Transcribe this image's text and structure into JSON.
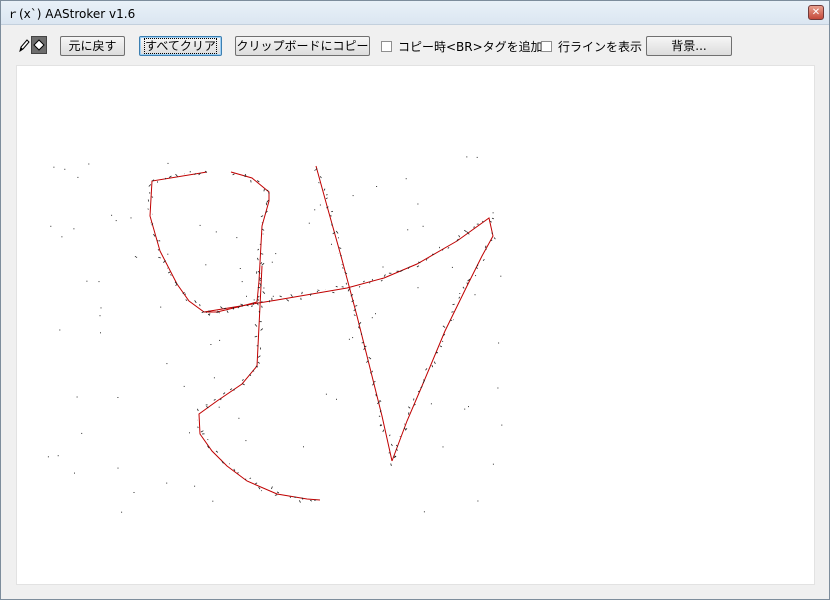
{
  "window": {
    "title": "ｒ(x`) AAStroker v1.6",
    "close_glyph": "✕"
  },
  "toolbar": {
    "undo_label": "元に戻す",
    "clear_all_label": "すべてクリア",
    "copy_label": "クリップボードにコピー",
    "br_tag_label": "コピー時<BR>タグを追加",
    "br_tag_checked": false,
    "show_lines_label": "行ラインを表示",
    "show_lines_checked": false,
    "background_label": "背景..."
  },
  "icons": {
    "pen": "pencil-icon",
    "eraser": "eraser-icon",
    "close": "close-icon"
  },
  "colors": {
    "stroke": "#c00000",
    "ascii_marks": "#000000",
    "canvas": "#ffffff"
  }
}
